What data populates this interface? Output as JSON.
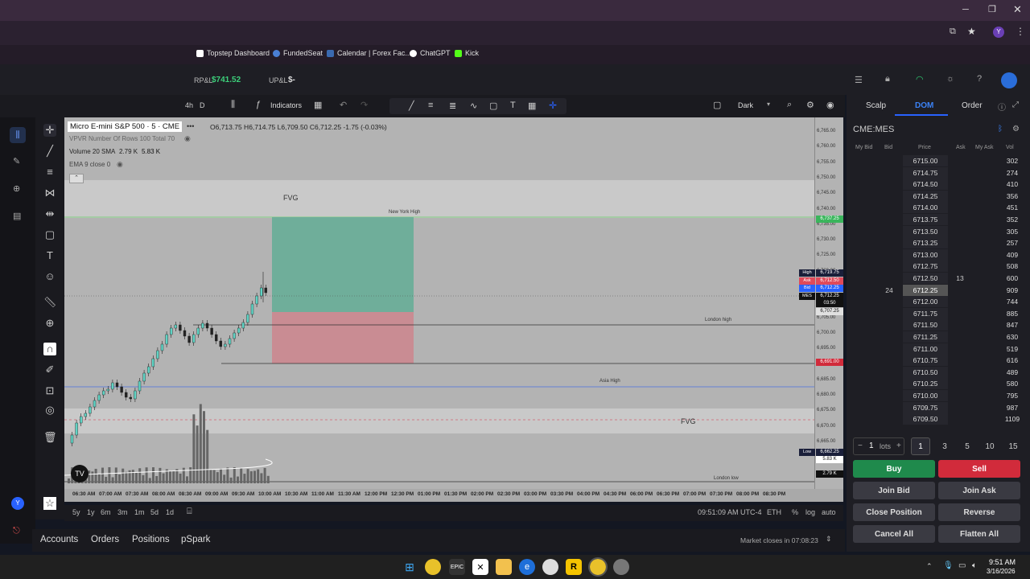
{
  "bookmarks": [
    {
      "label": "Topstep Dashboard",
      "color": "#ffffff"
    },
    {
      "label": "FundedSeat",
      "color": "#4a7fd4"
    },
    {
      "label": "Calendar | Forex Fac...",
      "color": "#3a6ab0"
    },
    {
      "label": "ChatGPT",
      "color": "#ffffff"
    },
    {
      "label": "Kick",
      "color": "#53fc18"
    }
  ],
  "header": {
    "rpl_label": "RP&L",
    "rpl_value": "$741.52",
    "upl_label": "UP&L",
    "upl_value": "$-"
  },
  "toolbar": {
    "timeframe": "4h",
    "tf2": "D",
    "indicators_label": "Indicators",
    "theme_label": "Dark"
  },
  "legend": {
    "symbol": "Micro E-mini S&P 500 · 5 · CME",
    "ohlc": "O6,713.75  H6,714.75  L6,709.50  C6,712.25  -1.75 (-0.03%)",
    "vpvr": "VPVR Number Of Rows 100 Total 70",
    "volume": "Volume 20 SMA",
    "vol_a": "2.79 K",
    "vol_b": "5.83 K",
    "ema": "EMA 9 close 0"
  },
  "annotations": {
    "fvg_top": "FVG",
    "fvg_bottom": "FVG",
    "ny_high": "New York High",
    "london_high": "London high",
    "asia_high": "Asia High",
    "london_low": "London low"
  },
  "price_axis": [
    "6,765.00",
    "6,760.00",
    "6,755.00",
    "6,750.00",
    "6,745.00",
    "6,740.00",
    "6,735.00",
    "6,730.00",
    "6,725.00",
    "6,720.00",
    "6,715.00",
    "6,710.00",
    "6,705.00",
    "6,700.00",
    "6,695.00",
    "6,690.00",
    "6,685.00",
    "6,680.00",
    "6,675.00",
    "6,670.00",
    "6,665.00",
    "6,660.00"
  ],
  "price_tags": {
    "ny": "6,737.25",
    "high_lbl": "High",
    "high": "6,719.75",
    "ask_lbl": "Ask",
    "ask": "6,712.50",
    "bid_lbl": "Bid",
    "bid": "6,712.25",
    "mes_lbl": "MES",
    "mes": "6,712.25",
    "timer": "03:50",
    "p1": "6,707.25",
    "p2": "6,691.00",
    "low_lbl": "Low",
    "low": "6,662.25",
    "v1": "5.83 K",
    "v2": "2.79 K"
  },
  "time_axis": [
    "06:30 AM",
    "07:00 AM",
    "07:30 AM",
    "08:00 AM",
    "08:30 AM",
    "09:00 AM",
    "09:30 AM",
    "10:00 AM",
    "10:30 AM",
    "11:00 AM",
    "11:30 AM",
    "12:00 PM",
    "12:30 PM",
    "01:00 PM",
    "01:30 PM",
    "02:00 PM",
    "02:30 PM",
    "03:00 PM",
    "03:30 PM",
    "04:00 PM",
    "04:30 PM",
    "06:00 PM",
    "06:30 PM",
    "07:00 PM",
    "07:30 PM",
    "08:00 PM",
    "08:30 PM"
  ],
  "ranges": [
    "5y",
    "1y",
    "6m",
    "3m",
    "1m",
    "5d",
    "1d"
  ],
  "footer_right": {
    "clock": "09:51:09 AM UTC-4",
    "session": "ETH",
    "pct": "%",
    "log": "log",
    "auto": "auto"
  },
  "bottom": {
    "tabs": [
      "Accounts",
      "Orders",
      "Positions",
      "pSpark"
    ],
    "market_status": "Market closes in 07:08:23"
  },
  "panel": {
    "tabs": [
      "Scalp",
      "DOM",
      "Order"
    ],
    "symbol": "CME:MES",
    "cols": [
      "My Bid",
      "Bid",
      "Price",
      "Ask",
      "My Ask",
      "Vol"
    ],
    "rows": [
      {
        "price": "6715.00",
        "ask": "",
        "bid": "",
        "vol": "302"
      },
      {
        "price": "6714.75",
        "ask": "",
        "bid": "",
        "vol": "274"
      },
      {
        "price": "6714.50",
        "ask": "",
        "bid": "",
        "vol": "410"
      },
      {
        "price": "6714.25",
        "ask": "",
        "bid": "",
        "vol": "356"
      },
      {
        "price": "6714.00",
        "ask": "",
        "bid": "",
        "vol": "451"
      },
      {
        "price": "6713.75",
        "ask": "",
        "bid": "",
        "vol": "352"
      },
      {
        "price": "6713.50",
        "ask": "",
        "bid": "",
        "vol": "305"
      },
      {
        "price": "6713.25",
        "ask": "",
        "bid": "",
        "vol": "257"
      },
      {
        "price": "6713.00",
        "ask": "",
        "bid": "",
        "vol": "409"
      },
      {
        "price": "6712.75",
        "ask": "",
        "bid": "",
        "vol": "508"
      },
      {
        "price": "6712.50",
        "ask": "13",
        "bid": "",
        "vol": "600"
      },
      {
        "price": "6712.25",
        "ask": "",
        "bid": "24",
        "vol": "909"
      },
      {
        "price": "6712.00",
        "ask": "",
        "bid": "",
        "vol": "744"
      },
      {
        "price": "6711.75",
        "ask": "",
        "bid": "",
        "vol": "885"
      },
      {
        "price": "6711.50",
        "ask": "",
        "bid": "",
        "vol": "847"
      },
      {
        "price": "6711.25",
        "ask": "",
        "bid": "",
        "vol": "630"
      },
      {
        "price": "6711.00",
        "ask": "",
        "bid": "",
        "vol": "519"
      },
      {
        "price": "6710.75",
        "ask": "",
        "bid": "",
        "vol": "616"
      },
      {
        "price": "6710.50",
        "ask": "",
        "bid": "",
        "vol": "489"
      },
      {
        "price": "6710.25",
        "ask": "",
        "bid": "",
        "vol": "580"
      },
      {
        "price": "6710.00",
        "ask": "",
        "bid": "",
        "vol": "795"
      },
      {
        "price": "6709.75",
        "ask": "",
        "bid": "",
        "vol": "987"
      },
      {
        "price": "6709.50",
        "ask": "",
        "bid": "",
        "vol": "1109"
      }
    ],
    "qty": "1",
    "qty_unit": "lots",
    "presets": [
      "1",
      "3",
      "5",
      "10",
      "15"
    ],
    "buy": "Buy",
    "sell": "Sell",
    "join_bid": "Join Bid",
    "join_ask": "Join Ask",
    "close_position": "Close Position",
    "reverse": "Reverse",
    "cancel_all": "Cancel All",
    "flatten_all": "Flatten All"
  },
  "taskbar": {
    "time": "9:51 AM",
    "date": "3/16/2026"
  },
  "colors": {
    "buy": "#1f8a4c",
    "sell": "#d12b3b",
    "accent": "#2962ff",
    "up": "#4fd1c5",
    "down": "#1a1a1a"
  }
}
